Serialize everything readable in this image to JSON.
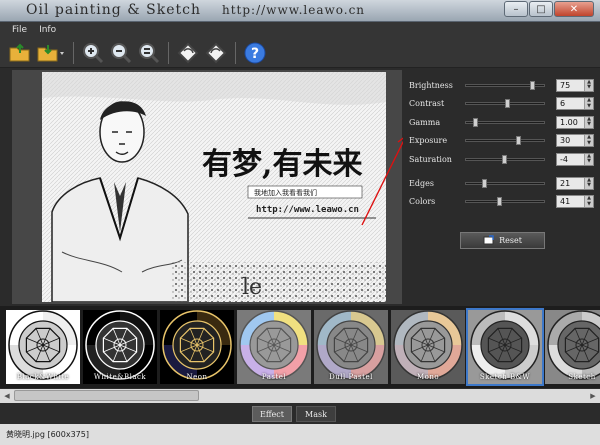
{
  "window": {
    "title": "Oil painting & Sketch",
    "url": "http://www.leawo.cn",
    "minimize": "–",
    "maximize": "□",
    "close": "✕"
  },
  "menu": [
    "File",
    "Info"
  ],
  "toolbar": {
    "icons": [
      "open-folder-icon",
      "save-icon",
      "zoom-in-icon",
      "zoom-out-icon",
      "zoom-fit-icon",
      "rotate-left-icon",
      "rotate-right-icon",
      "help-icon"
    ]
  },
  "image": {
    "headline": "有梦,有未来",
    "subline": "我地加入我看看我们",
    "url": "http://www.leawo.cn",
    "watermark": "le"
  },
  "controls": {
    "sliders": [
      {
        "label": "Brightness",
        "value": "75",
        "fraction": 0.86
      },
      {
        "label": "Contrast",
        "value": "6",
        "fraction": 0.53
      },
      {
        "label": "Gamma",
        "value": "1.00",
        "fraction": 0.1
      },
      {
        "label": "Exposure",
        "value": "30",
        "fraction": 0.68
      },
      {
        "label": "Saturation",
        "value": "-4",
        "fraction": 0.48
      }
    ],
    "sliders2": [
      {
        "label": "Edges",
        "value": "21",
        "fraction": 0.22
      },
      {
        "label": "Colors",
        "value": "41",
        "fraction": 0.42
      }
    ],
    "reset_label": "Reset"
  },
  "effects": [
    {
      "label": "Black&White",
      "style": "bw",
      "selected": false
    },
    {
      "label": "White&Black",
      "style": "wb",
      "selected": false
    },
    {
      "label": "Neon",
      "style": "neon",
      "selected": false
    },
    {
      "label": "Pastel",
      "style": "pastel",
      "selected": false
    },
    {
      "label": "Dull Pastel",
      "style": "dull",
      "selected": false
    },
    {
      "label": "Mono",
      "style": "mono",
      "selected": false
    },
    {
      "label": "Sketch B&W",
      "style": "sketch",
      "selected": true
    },
    {
      "label": "Sketch",
      "style": "sketch2",
      "selected": false
    }
  ],
  "tabs": [
    {
      "label": "Effect",
      "active": true
    },
    {
      "label": "Mask",
      "active": false
    }
  ],
  "status": "黄晓明.jpg [600x375]"
}
